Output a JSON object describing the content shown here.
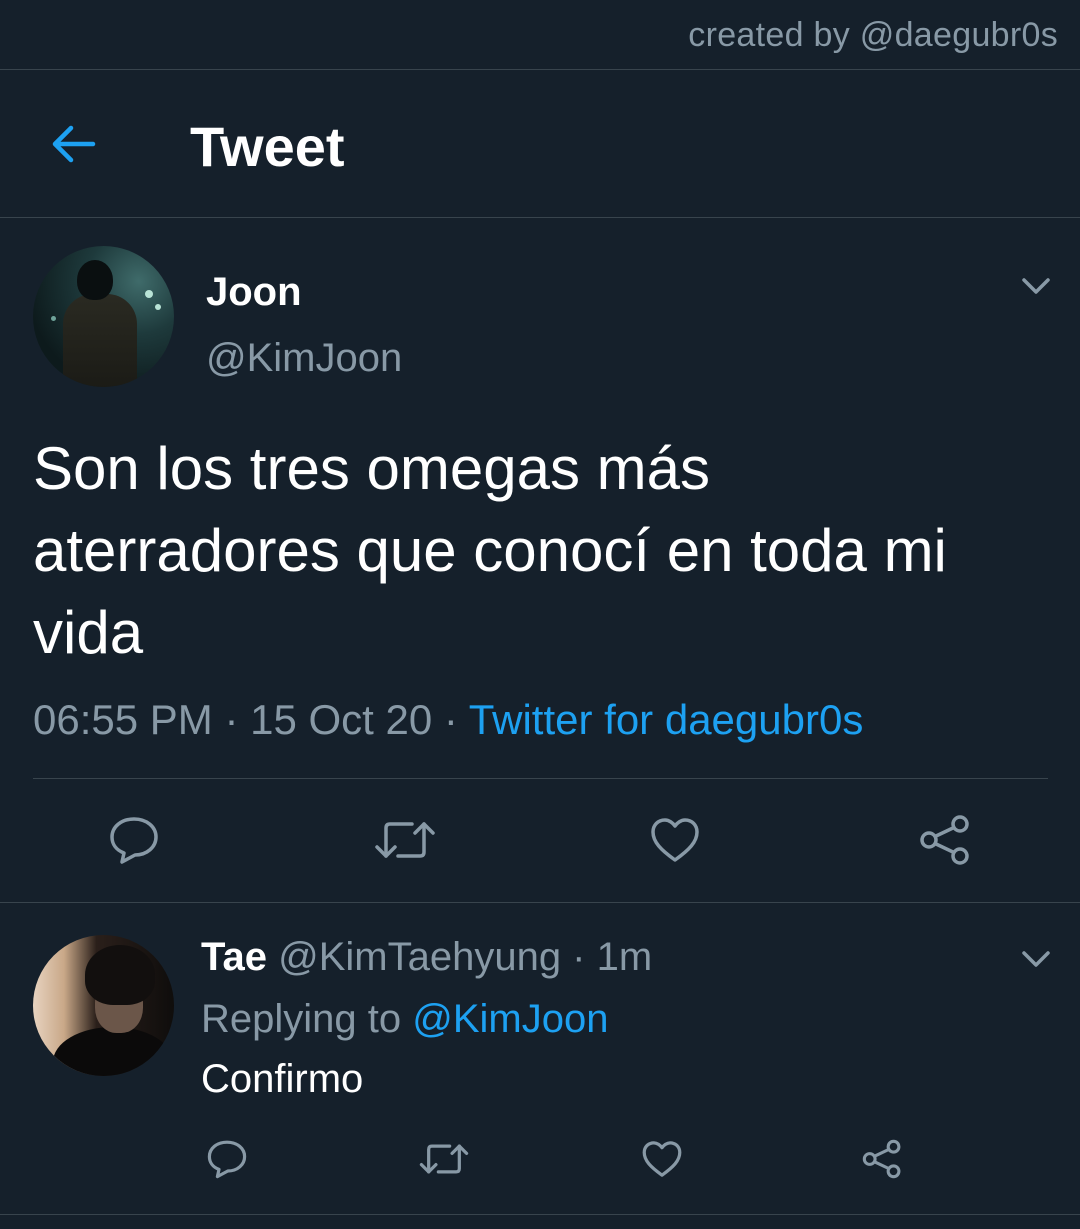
{
  "credit": {
    "text": "created by @daegubr0s"
  },
  "header": {
    "title": "Tweet",
    "back_icon": "arrow-left-icon"
  },
  "colors": {
    "background": "#15202b",
    "accent": "#1da1f2",
    "secondary_text": "#8899a6",
    "divider": "#38444d"
  },
  "tweet": {
    "name": "Joon",
    "handle": "@KimJoon",
    "text_lines": [
      "Son los tres omegas más",
      "aterradores que conocí en toda mi",
      "vida"
    ],
    "time": "06:55 PM",
    "sep1": " · ",
    "date": "15 Oct 20",
    "sep2": " · ",
    "source": "Twitter for daegubr0s",
    "actions": [
      "reply-icon",
      "retweet-icon",
      "like-icon",
      "share-icon"
    ]
  },
  "reply": {
    "name": "Tae",
    "handle": "@KimTaehyung",
    "dot": " · ",
    "time": "1m",
    "replying_prefix": "Replying to ",
    "replying_to": "@KimJoon",
    "text": "Confirmo",
    "actions": [
      "reply-icon",
      "retweet-icon",
      "like-icon",
      "share-icon"
    ]
  }
}
